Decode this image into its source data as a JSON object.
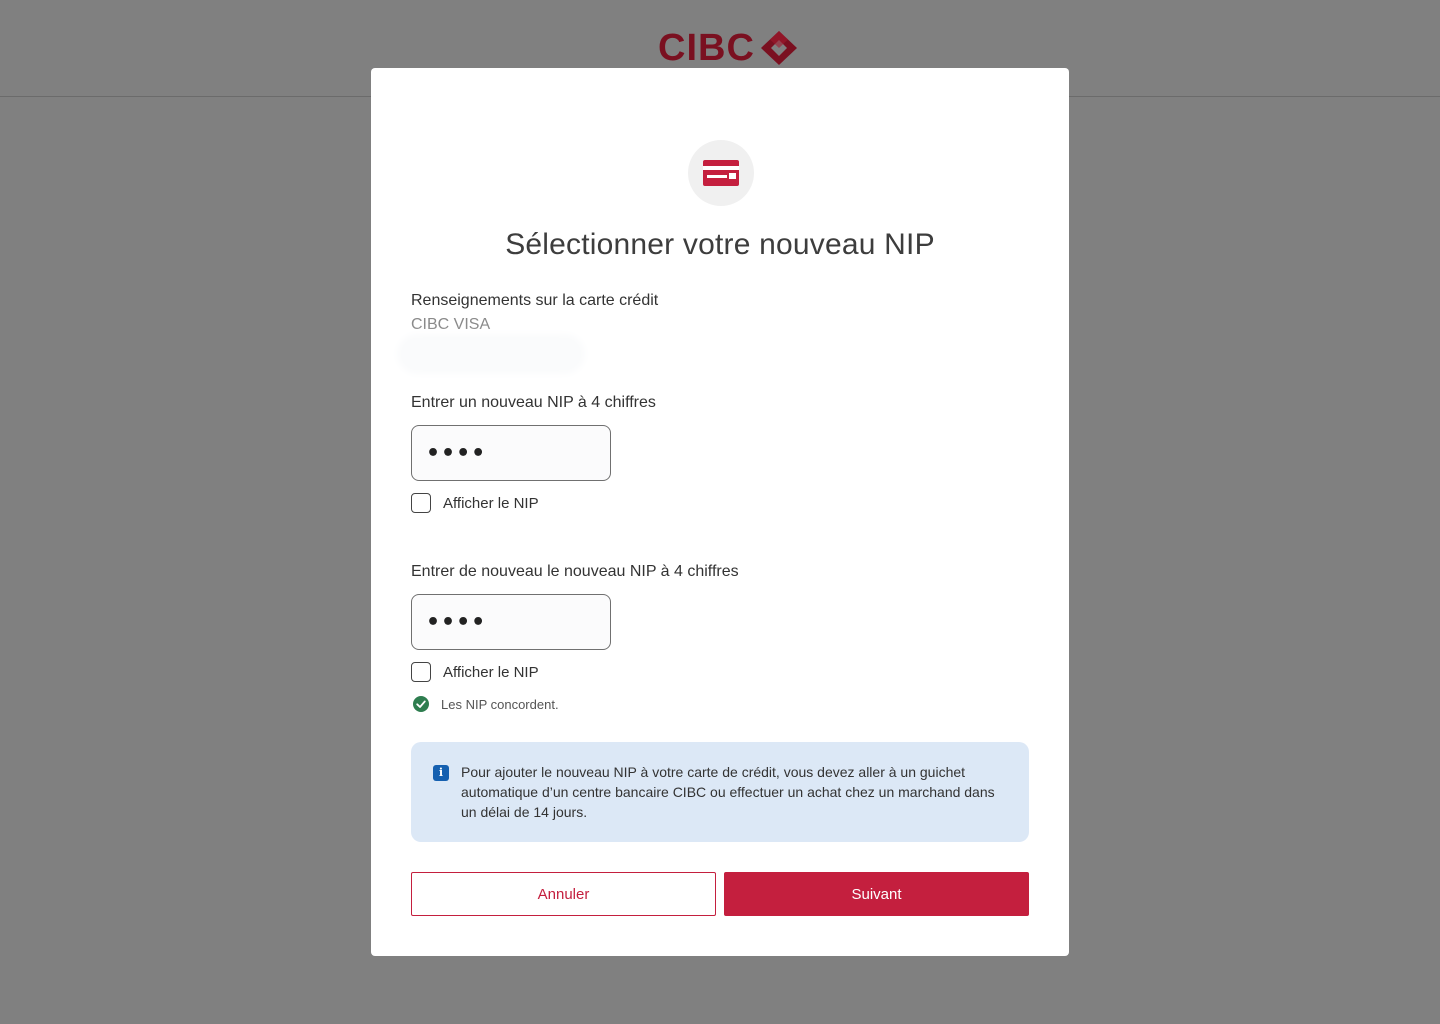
{
  "brand": {
    "logo_text": "CIBC",
    "color": "#7a1020"
  },
  "modal": {
    "title": "Sélectionner votre nouveau NIP",
    "card_info_label": "Renseignements sur la carte crédit",
    "card_name": "CIBC VISA",
    "pin_label": "Entrer un nouveau NIP à 4 chiffres",
    "pin_value": "••••",
    "show_pin_label": "Afficher le NIP",
    "confirm_label": "Entrer de nouveau le nouveau NIP à 4 chiffres",
    "confirm_value": "••••",
    "confirm_show_pin_label": "Afficher le NIP",
    "match_message": "Les NIP concordent.",
    "info_message": "Pour ajouter le nouveau NIP à votre carte de crédit, vous devez aller à un guichet automatique d’un centre bancaire CIBC ou effectuer un achat chez un marchand dans un délai de 14 jours.",
    "cancel_label": "Annuler",
    "next_label": "Suivant"
  },
  "icons": {
    "card": "credit-card-icon",
    "info": "info-icon",
    "check": "check-circle-icon"
  },
  "colors": {
    "primary": "#c41f3e",
    "info_bg": "#dce8f6",
    "success": "#2e7d4f",
    "overlay": "#808080"
  }
}
